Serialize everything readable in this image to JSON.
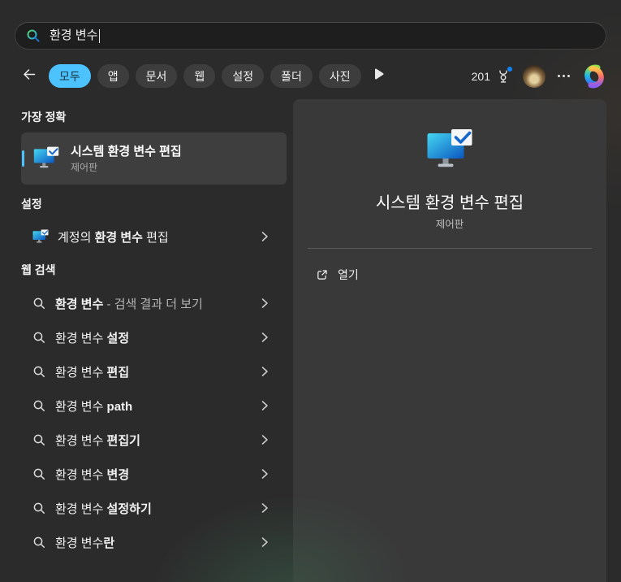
{
  "colors": {
    "accent": "#4cc2ff",
    "notification_badge": "#0a84ff"
  },
  "search": {
    "value": "환경 변수"
  },
  "filters": {
    "tabs": [
      {
        "label": "모두",
        "selected": true
      },
      {
        "label": "앱",
        "selected": false
      },
      {
        "label": "문서",
        "selected": false
      },
      {
        "label": "웹",
        "selected": false
      },
      {
        "label": "설정",
        "selected": false
      },
      {
        "label": "폴더",
        "selected": false
      },
      {
        "label": "사진",
        "selected": false
      }
    ]
  },
  "topbar": {
    "rewards_count": "201"
  },
  "sections": {
    "best_match": {
      "heading": "가장 정확",
      "item": {
        "title": "시스템 환경 변수 편집",
        "subtitle": "제어판"
      }
    },
    "settings": {
      "heading": "설정",
      "items": [
        {
          "segments": [
            {
              "t": "계정의 ",
              "b": false
            },
            {
              "t": "환경 변수",
              "b": true
            },
            {
              "t": " 편집",
              "b": false
            }
          ]
        }
      ]
    },
    "web": {
      "heading": "웹 검색",
      "items": [
        {
          "segments": [
            {
              "t": "환경 변수",
              "b": true
            },
            {
              "t": " - 검색 결과 더 보기",
              "b": false,
              "dim": true
            }
          ]
        },
        {
          "segments": [
            {
              "t": "환경 변수 ",
              "b": false
            },
            {
              "t": "설정",
              "b": true
            }
          ]
        },
        {
          "segments": [
            {
              "t": "환경 변수 ",
              "b": false
            },
            {
              "t": "편집",
              "b": true
            }
          ]
        },
        {
          "segments": [
            {
              "t": "환경 변수 ",
              "b": false
            },
            {
              "t": "path",
              "b": true
            }
          ]
        },
        {
          "segments": [
            {
              "t": "환경 변수 ",
              "b": false
            },
            {
              "t": "편집기",
              "b": true
            }
          ]
        },
        {
          "segments": [
            {
              "t": "환경 변수 ",
              "b": false
            },
            {
              "t": "변경",
              "b": true
            }
          ]
        },
        {
          "segments": [
            {
              "t": "환경 변수 ",
              "b": false
            },
            {
              "t": "설정하기",
              "b": true
            }
          ]
        },
        {
          "segments": [
            {
              "t": "환경 변수",
              "b": false
            },
            {
              "t": "란",
              "b": true
            }
          ]
        }
      ]
    }
  },
  "preview": {
    "title": "시스템 환경 변수 편집",
    "subtitle": "제어판",
    "open_label": "열기"
  }
}
